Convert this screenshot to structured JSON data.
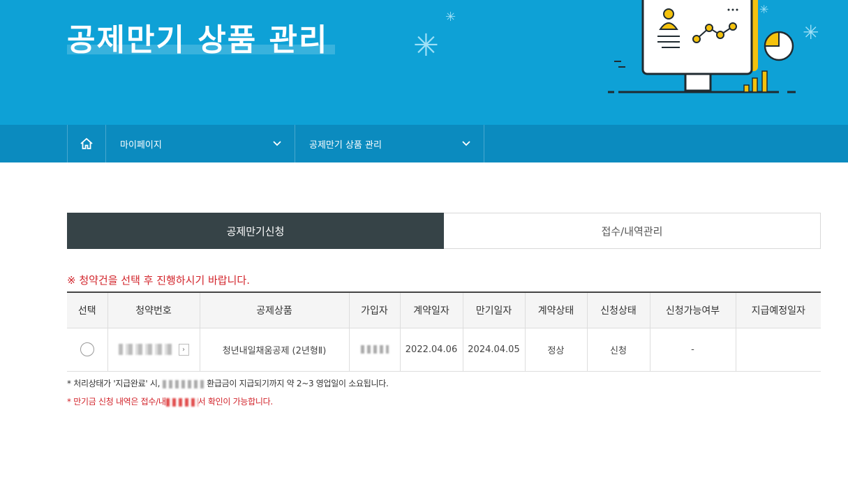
{
  "hero": {
    "title": "공제만기 상품 관리"
  },
  "breadcrumb": {
    "home_icon": "home-icon",
    "items": [
      {
        "label": "마이페이지",
        "icon": "chevron-down-icon"
      },
      {
        "label": "공제만기 상품 관리",
        "icon": "chevron-down-icon"
      }
    ]
  },
  "tabs": [
    {
      "label": "공제만기신청",
      "active": true
    },
    {
      "label": "접수/내역관리",
      "active": false
    }
  ],
  "notice": "※ 청약건을 선택 후 진행하시기 바랍니다.",
  "table": {
    "headers": [
      "선택",
      "청약번호",
      "공제상품",
      "가입자",
      "계약일자",
      "만기일자",
      "계약상태",
      "신청상태",
      "신청가능여부",
      "지급예정일자"
    ],
    "rows": [
      {
        "contract_no": "",
        "product": "청년내일채움공제 (2년형Ⅱ)",
        "subscriber": "",
        "contract_date": "2022.04.06",
        "maturity_date": "2024.04.05",
        "contract_status": "정상",
        "apply_status": "신청",
        "apply_possible": "-",
        "pay_date": ""
      }
    ]
  },
  "notes": {
    "line1_before": "* 처리상태가 '지급완료' 시, ",
    "line1_after": " 환급금이 지급되기까지 약 2~3 영업일이 소요됩니다.",
    "line2_before": "* 만기금 신청 내역은 접수/내",
    "line2_after": "서 확인이 가능합니다."
  },
  "colors": {
    "hero_bg": "#0ea1d6",
    "breadcrumb_bg": "#0b8bbf",
    "tab_active_bg": "#364347",
    "notice": "#d2232a"
  }
}
